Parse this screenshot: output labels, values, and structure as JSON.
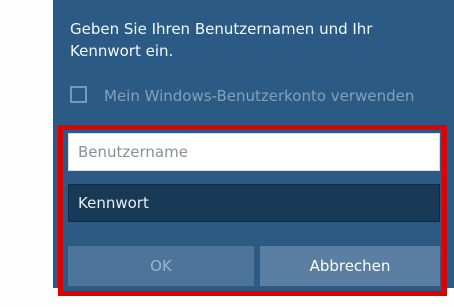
{
  "dialog": {
    "prompt": "Geben Sie Ihren Benutzernamen und Ihr Kennwort ein.",
    "checkbox_label": "Mein Windows-Benutzerkonto verwenden",
    "username_placeholder": "Benutzername",
    "password_placeholder": "Kennwort",
    "ok_label": "OK",
    "cancel_label": "Abbrechen",
    "colors": {
      "background": "#2b5a85",
      "highlight_frame": "#e10000",
      "password_field": "#183a56"
    }
  }
}
